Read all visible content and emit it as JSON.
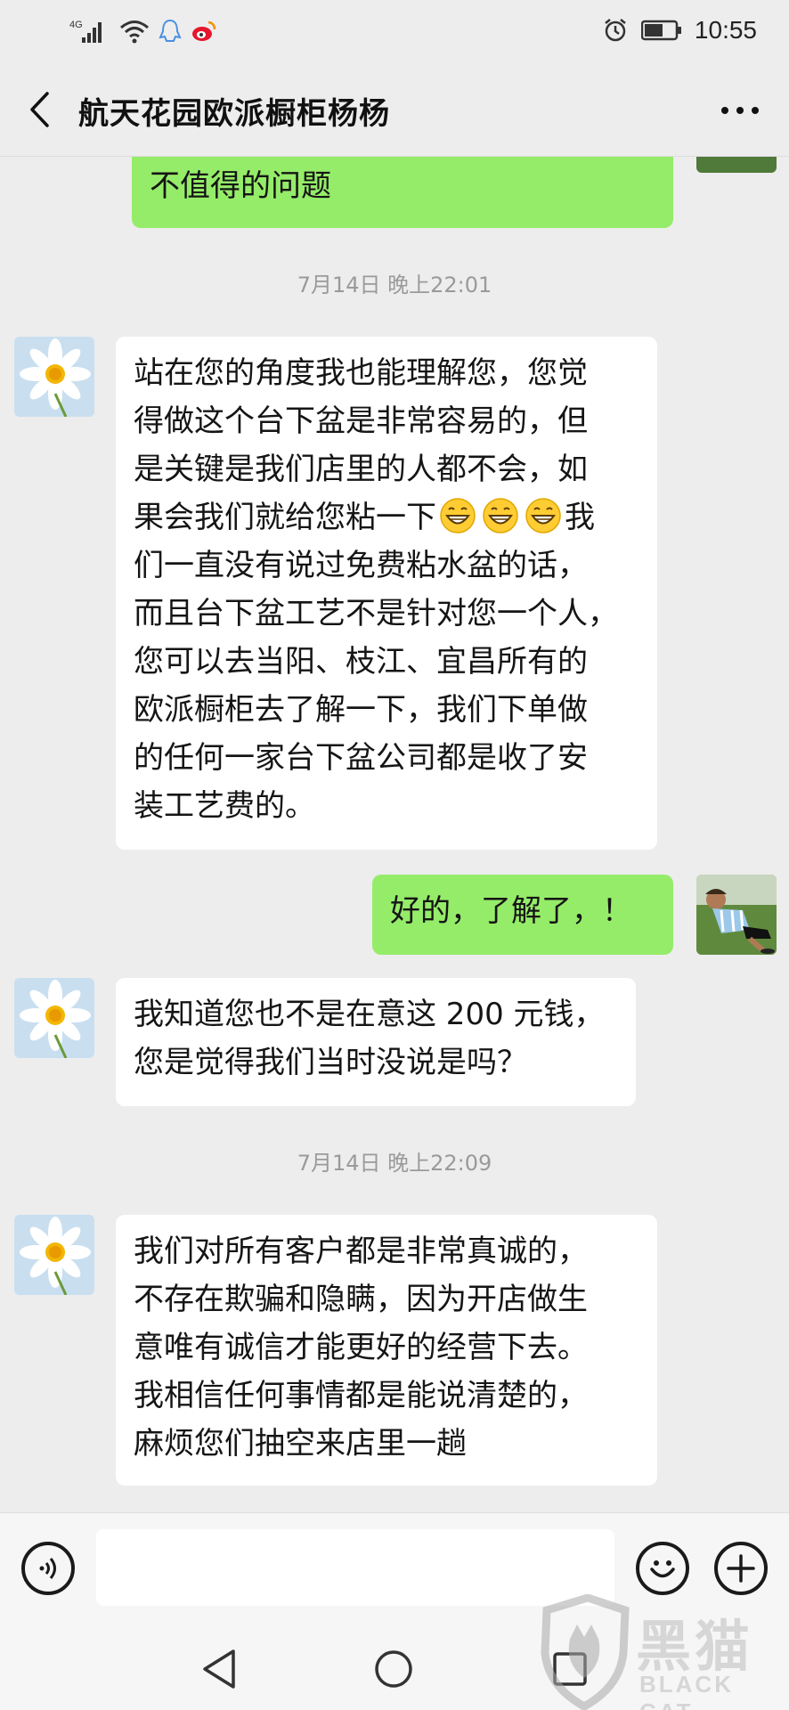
{
  "status_bar": {
    "network": "4G",
    "time": "10:55"
  },
  "header": {
    "title": "航天花园欧派橱柜杨杨",
    "back_icon": "chevron-left-icon",
    "more_icon": "more-dots-icon"
  },
  "messages": [
    {
      "side": "out",
      "lines": [
        "不值得的问题"
      ]
    },
    {
      "type": "timestamp",
      "text": "7月14日 晚上22:01"
    },
    {
      "side": "in",
      "lines": [
        "站在您的角度我也能理解您，您觉",
        "得做这个台下盆是非常容易的，但",
        "是关键是我们店里的人都不会，如",
        "果会我们就给您粘一下",
        "们一直没有说过免费粘水盆的话，",
        "而且台下盆工艺不是针对您一个人，",
        "您可以去当阳、枝江、宜昌所有的",
        "欧派橱柜去了解一下，我们下单做",
        "的任何一家台下盆公司都是收了安",
        "装工艺费的。"
      ],
      "line4_suffix": "我",
      "emoji": "grinning-face-icon"
    },
    {
      "side": "out",
      "lines": [
        "好的，了解了，！"
      ]
    },
    {
      "side": "in",
      "lines": [
        "我知道您也不是在意这 200 元钱，",
        "您是觉得我们当时没说是吗？"
      ]
    },
    {
      "type": "timestamp",
      "text": "7月14日 晚上22:09"
    },
    {
      "side": "in",
      "lines": [
        "我们对所有客户都是非常真诚的，",
        "不存在欺骗和隐瞒，因为开店做生",
        "意唯有诚信才能更好的经营下去。",
        "我相信任何事情都是能说清楚的，",
        "麻烦您们抽空来店里一趟"
      ]
    }
  ],
  "input_bar": {
    "voice_icon": "voice-icon",
    "emoji_icon": "emoji-icon",
    "plus_icon": "plus-icon",
    "value": ""
  },
  "watermark": {
    "cn": "黑猫",
    "en": "BLACK CAT"
  },
  "colors": {
    "background": "#ededed",
    "outgoing_bubble": "#95ec69",
    "incoming_bubble": "#ffffff",
    "timestamp": "#9a9a9a"
  }
}
